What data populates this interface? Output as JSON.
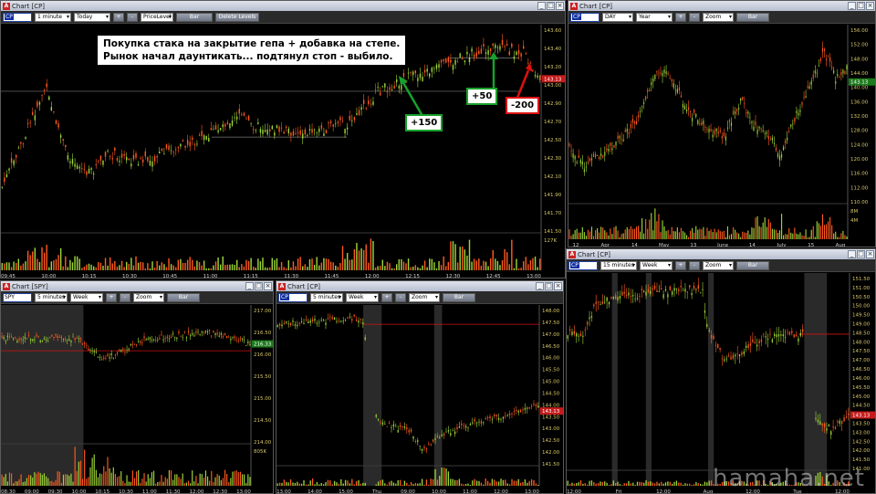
{
  "windows": {
    "main": {
      "title": "Chart [CP]",
      "symbol": "CP",
      "interval": "1 minute",
      "range": "Today",
      "study": "PriceLevel",
      "type_btn": "Bar",
      "delete_btn": "Delete Levels",
      "plus": "+",
      "minus": "-",
      "yticks": [
        "143.60",
        "143.40",
        "143.20",
        "143.00",
        "142.90",
        "142.70",
        "142.50",
        "142.30",
        "142.10",
        "141.90",
        "141.70",
        "141.50"
      ],
      "xticks": [
        "09:45",
        "10:00",
        "10:15",
        "10:30",
        "10:45",
        "11:00",
        "11:15",
        "11:30",
        "11:45",
        "12:00",
        "12:15",
        "12:30",
        "12:45",
        "13:00"
      ],
      "last_price": "143.13",
      "vol_label": "127K",
      "annotation_line1": "Покупка стака на закрытие гепа + добавка на степе.",
      "annotation_line2": "Рынок начал даунтикать... подтянул стоп - выбило.",
      "tag_150": "+150",
      "tag_50": "+50",
      "tag_200": "-200"
    },
    "day": {
      "title": "Chart [CP]",
      "symbol": "CP",
      "interval": "DAY",
      "range": "Year",
      "zoom": "Zoom",
      "type_btn": "Bar",
      "plus": "+",
      "minus": "-",
      "yticks": [
        "156.00",
        "152.00",
        "148.00",
        "144.00",
        "140.00",
        "136.00",
        "132.00",
        "128.00",
        "124.00",
        "120.00",
        "116.00",
        "112.00",
        "110.00"
      ],
      "xticks": [
        "12",
        "Apr",
        "14",
        "May",
        "13",
        "June",
        "14",
        "July",
        "15",
        "Aug"
      ],
      "first_xtick": "Apr",
      "last_price": "143.13",
      "vol_labels": [
        "8M",
        "4M"
      ]
    },
    "spy": {
      "title": "Chart [SPY]",
      "symbol": "SPY",
      "interval": "5 minutes",
      "range": "Week",
      "zoom": "Zoom",
      "type_btn": "Bar",
      "plus": "+",
      "minus": "-",
      "yticks": [
        "217.00",
        "216.50",
        "216.00",
        "215.50",
        "215.00",
        "214.50",
        "214.00"
      ],
      "xticks": [
        "08:30",
        "09:00",
        "09:30",
        "10:00",
        "10:15",
        "10:30",
        "11:00",
        "11:30",
        "12:00",
        "12:30",
        "13:00"
      ],
      "last_price": "216.33",
      "vol_label": "805K"
    },
    "cp5": {
      "title": "Chart [CP]",
      "symbol": "CP",
      "interval": "5 minutes",
      "range": "Week",
      "zoom": "Zoom",
      "type_btn": "Bar",
      "plus": "+",
      "minus": "-",
      "yticks": [
        "148.00",
        "147.50",
        "147.00",
        "146.50",
        "146.00",
        "145.50",
        "145.00",
        "144.50",
        "144.00",
        "143.50",
        "143.00",
        "142.50",
        "142.00",
        "141.50"
      ],
      "xticks": [
        "13:00",
        "14:00",
        "15:00",
        "Thu",
        "09:00",
        "10:00",
        "11:00",
        "12:00",
        "13:00"
      ],
      "last_price": "143.13"
    },
    "cp15": {
      "title": "Chart [CP]",
      "symbol": "CP",
      "interval": "15 minutes",
      "range": "Week",
      "zoom": "Zoom",
      "type_btn": "Bar",
      "plus": "+",
      "minus": "-",
      "yticks": [
        "151.50",
        "151.00",
        "150.50",
        "150.00",
        "149.50",
        "149.00",
        "148.50",
        "148.00",
        "147.50",
        "147.00",
        "146.50",
        "146.00",
        "145.50",
        "145.00",
        "144.50",
        "144.00",
        "143.50",
        "143.00",
        "142.50",
        "142.00",
        "141.50",
        "141.00"
      ],
      "xticks": [
        "12:00",
        "Fri",
        "12:00",
        "Aug",
        "12:00",
        "Tue",
        "12:00"
      ],
      "last_price": "143.13"
    }
  },
  "watermark": "hamaha.net",
  "colors": {
    "up": "#9fd639",
    "down": "#ff5a1f",
    "level": "#d01010",
    "axis": "#d6c66a"
  }
}
